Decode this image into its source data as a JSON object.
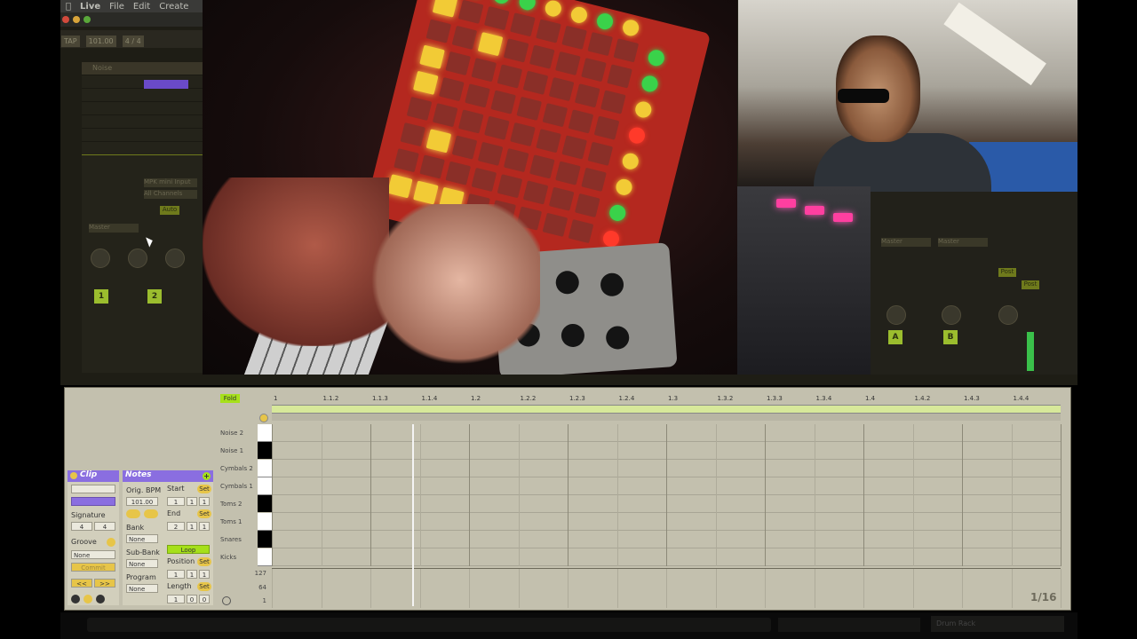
{
  "menubar": {
    "app": "Live",
    "items": [
      "File",
      "Edit",
      "Create"
    ]
  },
  "transport": {
    "tap": "TAP",
    "bpm": "101.00",
    "meter": "4 / 4"
  },
  "mixer": {
    "track_label": "Noise",
    "midi_input": "MPK mini Input",
    "channel": "All Channels",
    "monitor": "Auto",
    "audio_to": "Master",
    "track1": "1",
    "track2": "2",
    "return_a": "A",
    "return_b": "B",
    "post1": "Post",
    "post2": "Post"
  },
  "clip": {
    "header": "Clip",
    "signature_label": "Signature",
    "sig_num": "4",
    "sig_den": "4",
    "groove_label": "Groove",
    "groove_value": "None",
    "commit": "Commit",
    "nav_prev": "<<",
    "nav_next": ">>"
  },
  "notes": {
    "header": "Notes",
    "orig_bpm_label": "Orig. BPM",
    "orig_bpm_value": "101.00",
    "start_label": "Start",
    "start_values": [
      "1",
      "1",
      "1"
    ],
    "end_label": "End",
    "end_values": [
      "2",
      "1",
      "1"
    ],
    "set": "Set",
    "bank_label": "Bank",
    "bank_value": "None",
    "subbank_label": "Sub-Bank",
    "subbank_value": "None",
    "program_label": "Program",
    "program_value": "None",
    "loop": "Loop",
    "position_label": "Position",
    "position_values": [
      "1",
      "1",
      "1"
    ],
    "length_label": "Length",
    "length_values": [
      "1",
      "0",
      "0"
    ]
  },
  "piano_roll": {
    "fold": "Fold",
    "ruler": [
      "1",
      "1.1.2",
      "1.1.3",
      "1.1.4",
      "1.2",
      "1.2.2",
      "1.2.3",
      "1.2.4",
      "1.3",
      "1.3.2",
      "1.3.3",
      "1.3.4",
      "1.4",
      "1.4.2",
      "1.4.3",
      "1.4.4"
    ],
    "lanes": [
      {
        "name": "Noise 2",
        "key": "white"
      },
      {
        "name": "Noise 1",
        "key": "black"
      },
      {
        "name": "Cymbals 2",
        "key": "white"
      },
      {
        "name": "Cymbals 1",
        "key": "white"
      },
      {
        "name": "Toms 2",
        "key": "black"
      },
      {
        "name": "Toms 1",
        "key": "white"
      },
      {
        "name": "Snares",
        "key": "black"
      },
      {
        "name": "Kicks",
        "key": "white"
      }
    ],
    "velocity_labels": [
      "127",
      "64",
      "1"
    ],
    "grid_page": "1/16"
  },
  "status": {
    "text": "Drum Rack"
  },
  "colors": {
    "accent": "#8a6ee0",
    "lime": "#a6e01a",
    "pad_yellow": "#f2cb36",
    "launchpad_red": "#b4281f"
  }
}
